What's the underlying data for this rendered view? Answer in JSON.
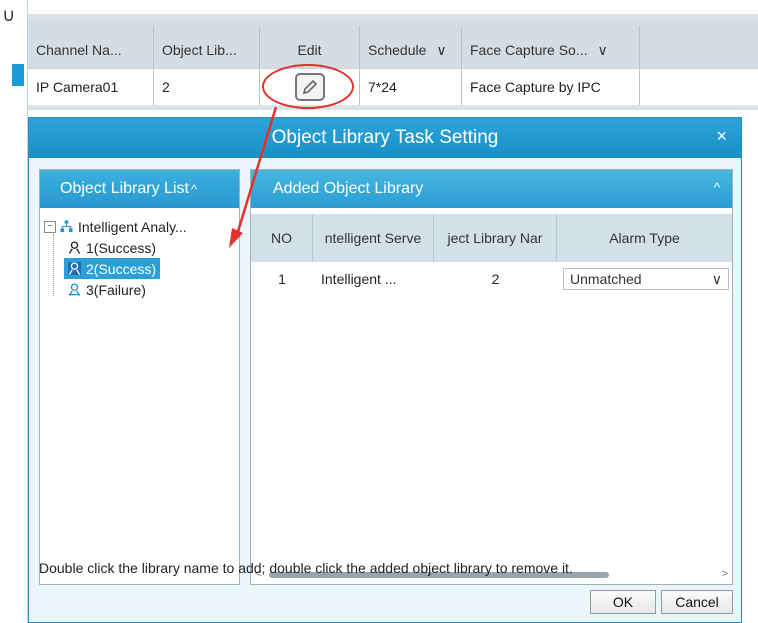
{
  "background_table": {
    "columns": [
      "Channel Na...",
      "Object Lib...",
      "Edit",
      "Schedule",
      "Face Capture So..."
    ],
    "row": {
      "channel": "IP Camera01",
      "object_lib": "2",
      "schedule": "7*24",
      "face_capture": "Face Capture by IPC"
    }
  },
  "dialog": {
    "title": "Object Library Task Setting",
    "close_label": "×",
    "left_panel": {
      "title": "Object Library List",
      "caret": "^",
      "tree_root": "Intelligent Analy...",
      "items": [
        "1(Success)",
        "2(Success)",
        "3(Failure)"
      ]
    },
    "right_panel": {
      "title": "Added Object Library",
      "caret": "^",
      "columns": [
        "NO",
        "ntelligent Serve",
        "ject Library Nar",
        "Alarm Type"
      ],
      "rows": [
        {
          "no": "1",
          "server": "Intelligent ...",
          "library": "2",
          "alarm_type": "Unmatched"
        }
      ]
    },
    "hint": "Double click the library name to add; double click the added object library to remove it.",
    "ok": "OK",
    "cancel": "Cancel"
  },
  "colors": {
    "accent": "#2aa0d6",
    "annotation": "#e6302a"
  }
}
